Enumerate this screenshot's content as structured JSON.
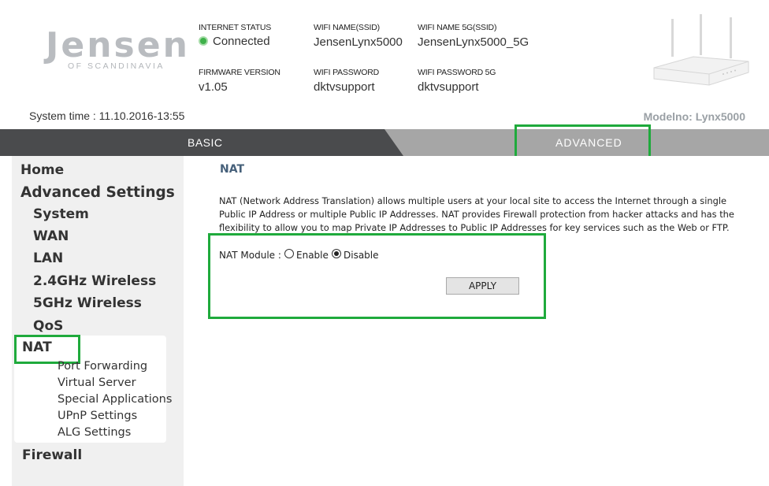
{
  "header": {
    "logo_word": "Jensen",
    "logo_sub": "OF SCANDINAVIA",
    "internet_status_label": "INTERNET STATUS",
    "internet_status_value": "Connected",
    "wifi_name_label": "WIFI NAME(SSID)",
    "wifi_name_value": "JensenLynx5000",
    "wifi_name_5g_label": "WIFI NAME 5G(SSID)",
    "wifi_name_5g_value": "JensenLynx5000_5G",
    "firmware_label": "FIRMWARE VERSION",
    "firmware_value": "v1.05",
    "wifi_password_label": "WIFI PASSWORD",
    "wifi_password_value": "dktvsupport",
    "wifi_password_5g_label": "WIFI PASSWORD 5G",
    "wifi_password_5g_value": "dktvsupport",
    "system_time": "System time :   11.10.2016-13:55",
    "model_no": "Modelno: Lynx5000",
    "status_color": "#3eb14a"
  },
  "tabs": {
    "basic": "BASIC",
    "advanced": "ADVANCED"
  },
  "sidebar": {
    "items": [
      {
        "label": "Home"
      },
      {
        "label": "Advanced Settings"
      },
      {
        "label": "System"
      },
      {
        "label": "WAN"
      },
      {
        "label": "LAN"
      },
      {
        "label": "2.4GHz Wireless"
      },
      {
        "label": "5GHz Wireless"
      },
      {
        "label": "QoS"
      },
      {
        "label": "NAT"
      },
      {
        "label": "Firewall"
      }
    ],
    "nat_subitems": [
      {
        "label": "Port Forwarding"
      },
      {
        "label": "Virtual Server"
      },
      {
        "label": "Special Applications"
      },
      {
        "label": "UPnP Settings"
      },
      {
        "label": "ALG Settings"
      }
    ]
  },
  "main": {
    "title": "NAT",
    "description": "NAT (Network Address Translation) allows multiple users at your local site to access the Internet through a single Public IP Address or multiple Public IP Addresses. NAT provides Firewall protection from hacker attacks and has the flexibility to allow you to map Private IP Addresses to Public IP Addresses for key services such as the Web or FTP.",
    "module_label": "NAT Module :",
    "enable_label": "Enable",
    "disable_label": "Disable",
    "selected": "Disable",
    "apply_label": "APPLY"
  },
  "colors": {
    "highlight": "#1faa3c",
    "tab_dark": "#4a4b4d",
    "tab_light": "#a6a6a6",
    "title_blue": "#46607a"
  }
}
